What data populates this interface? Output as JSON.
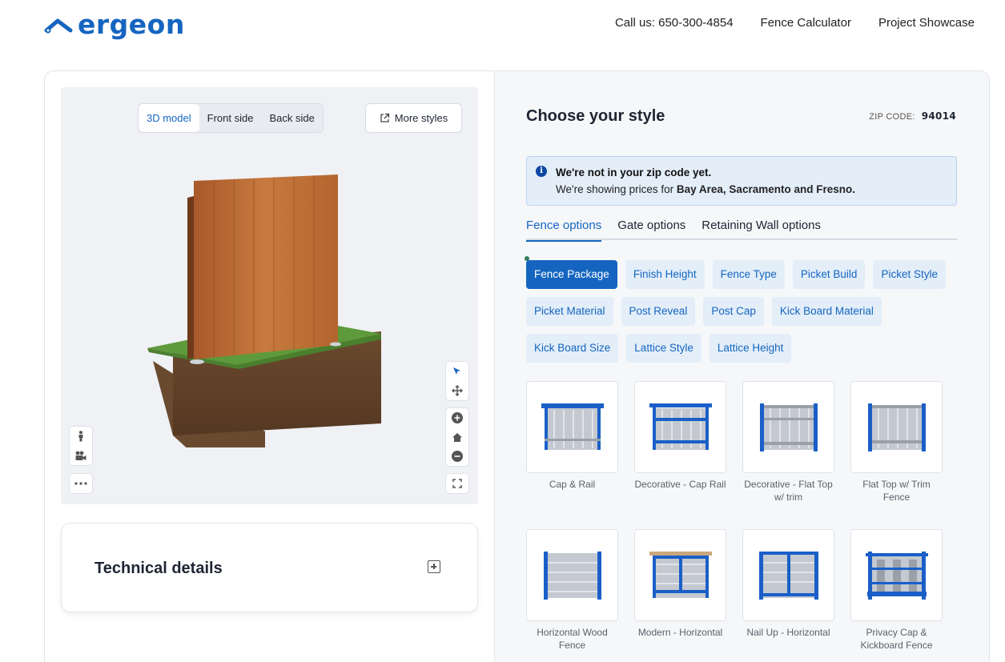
{
  "header": {
    "logo_text": "ergeon",
    "nav": [
      "Call us: 650-300-4854",
      "Fence Calculator",
      "Project Showcase"
    ]
  },
  "viewer": {
    "tabs": [
      "3D model",
      "Front side",
      "Back side"
    ],
    "active_tab": "3D model",
    "more_styles_label": "More styles"
  },
  "technical": {
    "title": "Technical details"
  },
  "style_panel": {
    "title": "Choose your style",
    "zip_label": "ZIP CODE:",
    "zip_value": "94014",
    "alert": {
      "title": "We're not in your zip code yet.",
      "body_prefix": "We're showing prices for ",
      "body_bold": "Bay Area, Sacramento and Fresno."
    },
    "option_tabs": [
      "Fence options",
      "Gate options",
      "Retaining Wall options"
    ],
    "active_option_tab": "Fence options",
    "chips": [
      "Fence Package",
      "Finish Height",
      "Fence Type",
      "Picket Build",
      "Picket Style",
      "Picket Material",
      "Post Reveal",
      "Post Cap",
      "Kick Board Material",
      "Kick Board Size",
      "Lattice Style",
      "Lattice Height"
    ],
    "active_chip": "Fence Package",
    "styles": [
      {
        "label": "Cap & Rail",
        "icon": "cap-rail-fence-icon"
      },
      {
        "label": "Decorative - Cap Rail",
        "icon": "decorative-cap-rail-icon"
      },
      {
        "label": "Decorative - Flat Top w/ trim",
        "icon": "decorative-flat-top-icon"
      },
      {
        "label": "Flat Top w/ Trim Fence",
        "icon": "flat-top-trim-icon"
      },
      {
        "label": "Horizontal Wood Fence",
        "icon": "horizontal-wood-icon"
      },
      {
        "label": "Modern - Horizontal",
        "icon": "modern-horizontal-icon"
      },
      {
        "label": "Nail Up - Horizontal",
        "icon": "nail-up-horizontal-icon"
      },
      {
        "label": "Privacy Cap & Kickboard Fence",
        "icon": "privacy-cap-kickboard-icon"
      }
    ]
  },
  "colors": {
    "brand": "#1565c0",
    "chip_bg": "#e3eef9",
    "alert_bg": "#e3eef9"
  }
}
